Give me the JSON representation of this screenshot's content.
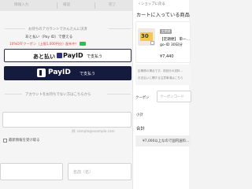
{
  "steps": {
    "info": "情報入力",
    "confirm": "確認",
    "done": "完了"
  },
  "checkout": {
    "section1_heading": "お持ちのアカウントでかんたんに決済",
    "promo_line1": "あと払い（Pay ID）で使える",
    "promo_line2": "10%OFFクーポン（上限1,000円分）配布中！",
    "promo_badge": "詳細",
    "atobarai_button": {
      "part1": "あと払い",
      "payid": "PayID",
      "part2": "で支払う"
    },
    "payid_button": {
      "payid": "PayID",
      "part2": "で支払う"
    },
    "section2_heading": "アカウントをお持ちでない方はこちらから",
    "email_note": "例: sample@example.com",
    "checkbox_label": "最新情報を受け取る",
    "last_name_placeholder": "",
    "first_name_placeholder": "名前（名）"
  },
  "cart": {
    "back_link": "ショップに戻る",
    "title": "カートに入っている商品",
    "product": {
      "badge": "定期便",
      "name_line1": "【定期便】 単一…",
      "name_line2": "go-ID 30日分",
      "price": "¥7,440",
      "thumb_text": "30"
    },
    "notes": [
      "定期便の場合です。前回分の送料…",
      "お支払いに関する注意事項はこちら"
    ],
    "coupon_label": "クーポン",
    "coupon_placeholder": "クーポンコード",
    "subtotal_label": "小計",
    "total_label": "合計",
    "shipping_banner": "¥7,000以上なので国内送料…"
  },
  "colors": {
    "payid_navy": "#151b3d",
    "promo_red": "#e0453a",
    "badge_gray": "#9e9e9e"
  }
}
